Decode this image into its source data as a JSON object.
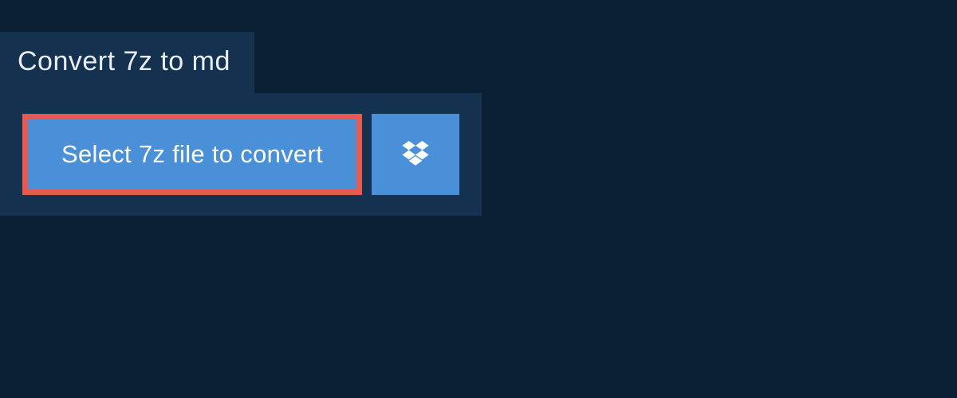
{
  "tab": {
    "title": "Convert 7z to md"
  },
  "actions": {
    "select_label": "Select 7z file to convert",
    "dropbox_icon": "dropbox"
  }
}
